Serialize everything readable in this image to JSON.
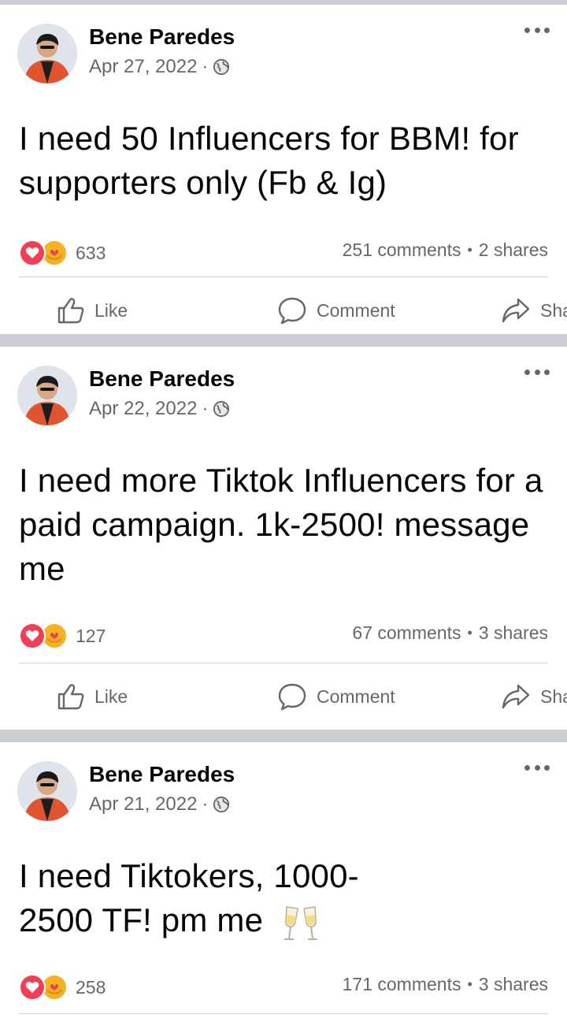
{
  "posts": [
    {
      "author": "Bene Paredes",
      "date": "Apr 27, 2022",
      "separator": "·",
      "text": "I need 50 Influencers for BBM! for supporters only (Fb & Ig)",
      "reaction_count": "633",
      "comments": "251 comments",
      "shares": "2 shares"
    },
    {
      "author": "Bene Paredes",
      "date": "Apr 22, 2022",
      "separator": "·",
      "text": "I need more Tiktok Influencers for a paid campaign. 1k-2500! message me",
      "reaction_count": "127",
      "comments": "67 comments",
      "shares": "3 shares"
    },
    {
      "author": "Bene Paredes",
      "date": "Apr 21, 2022",
      "separator": "·",
      "text": "I need Tiktokers, 1000-2500 TF! pm me",
      "emoji": "clinking-glasses-icon",
      "reaction_count": "258",
      "comments": "171 comments",
      "shares": "3 shares"
    }
  ],
  "actions": {
    "like": "Like",
    "comment": "Comment",
    "share": "Share"
  },
  "dot_separator": "•",
  "colors": {
    "text_primary": "#050505",
    "text_secondary": "#65676b",
    "love_reaction": "#f33e58",
    "care_reaction": "#f7b125",
    "feed_separator": "#c9ccd1"
  }
}
